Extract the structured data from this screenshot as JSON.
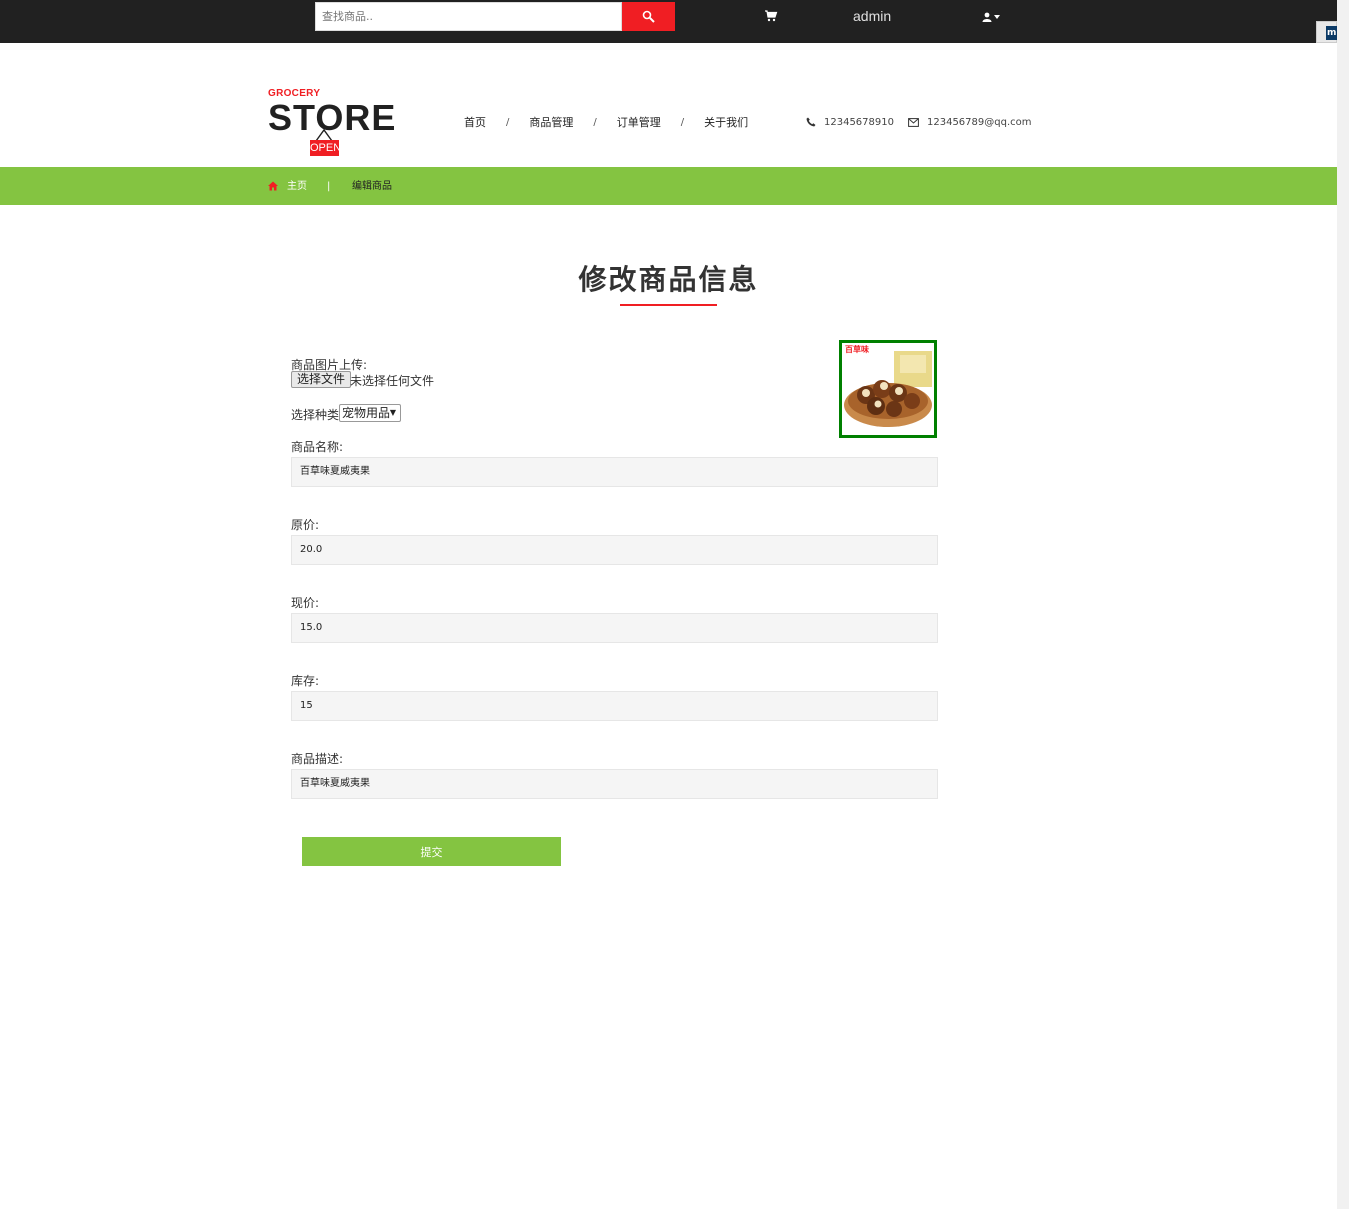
{
  "topbar": {
    "search_placeholder": "查找商品..",
    "username": "admin",
    "right_tab_label": "m"
  },
  "logo": {
    "line1": "GROCERY",
    "line2": "STORE",
    "sign": "OPEN"
  },
  "nav": {
    "items": [
      "首页",
      "商品管理",
      "订单管理",
      "关于我们"
    ],
    "separator": "/"
  },
  "contact": {
    "phone": "12345678910",
    "email": "123456789@qq.com"
  },
  "breadcrumb": {
    "home": "主页",
    "separator": "|",
    "current": "编辑商品"
  },
  "page": {
    "title": "修改商品信息"
  },
  "form": {
    "image_label": "商品图片上传:",
    "file_button": "选择文件",
    "file_status": "未选择任何文件",
    "category_label": "选择种类:",
    "category_value": "宠物用品",
    "name_label": "商品名称:",
    "name_value": "百草味夏威夷果",
    "original_price_label": "原价:",
    "original_price_value": "20.0",
    "current_price_label": "现价:",
    "current_price_value": "15.0",
    "stock_label": "库存:",
    "stock_value": "15",
    "description_label": "商品描述:",
    "description_value": "百草味夏威夷果",
    "submit_label": "提交"
  },
  "product_image": {
    "brand_text": "百草味"
  },
  "colors": {
    "accent_red": "#f01e23",
    "green": "#84c441",
    "topbar": "#212121",
    "image_border": "#008000"
  }
}
